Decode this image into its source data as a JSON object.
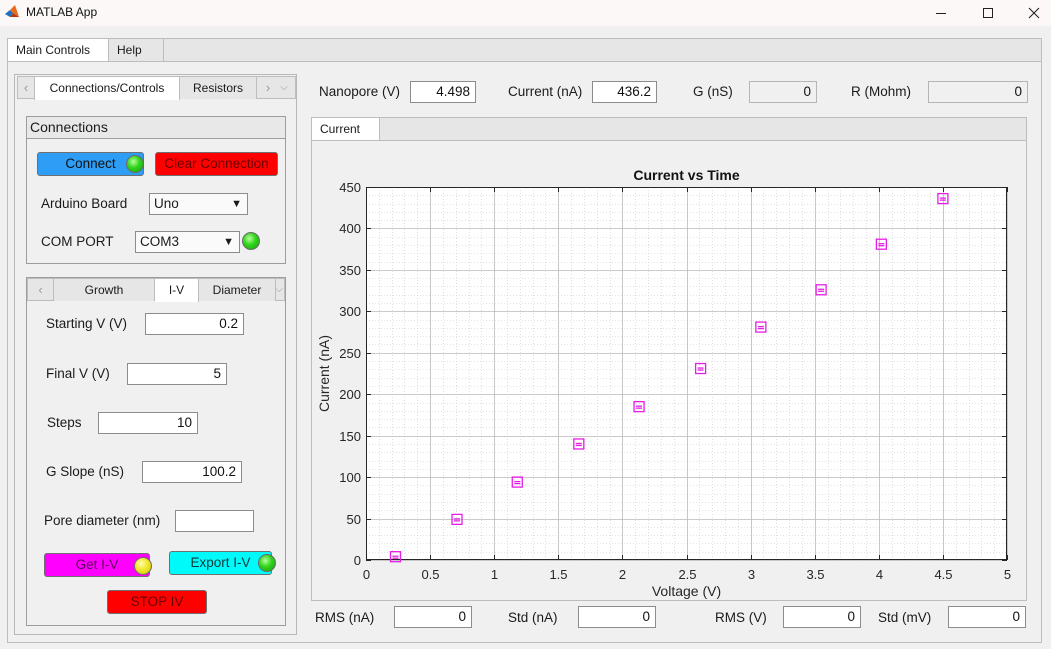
{
  "window": {
    "title": "MATLAB App"
  },
  "top_tabs": [
    {
      "label": "Main Controls"
    },
    {
      "label": "Help"
    }
  ],
  "left_tabs": [
    {
      "label": "Connections/Controls"
    },
    {
      "label": "Resistors"
    }
  ],
  "connections": {
    "title": "Connections",
    "connect_label": "Connect",
    "clear_label": "Clear Connection",
    "board_label": "Arduino Board",
    "board_value": "Uno",
    "port_label": "COM PORT",
    "port_value": "COM3"
  },
  "iv_tabs": [
    {
      "label": "Growth"
    },
    {
      "label": "I-V"
    },
    {
      "label": "Diameter"
    }
  ],
  "iv": {
    "starting_v_label": "Starting V (V)",
    "starting_v": "0.2",
    "final_v_label": "Final V  (V)",
    "final_v": "5",
    "steps_label": "Steps",
    "steps": "10",
    "g_slope_label": "G Slope (nS)",
    "g_slope": "100.2",
    "pore_label": "Pore diameter (nm)",
    "pore_value": "",
    "get_iv_label": "Get I-V",
    "export_iv_label": "Export I-V",
    "stop_label": "STOP IV"
  },
  "readouts": {
    "nanopore_label": "Nanopore (V)",
    "nanopore": "4.498",
    "current_label": "Current (nA)",
    "current": "436.2",
    "g_label": "G (nS)",
    "g": "0",
    "r_label": "R (Mohm)",
    "r": "0"
  },
  "plot_tab": {
    "label": "Current"
  },
  "bottom": {
    "rms_na_label": "RMS (nA)",
    "rms_na": "0",
    "std_na_label": "Std (nA)",
    "std_na": "0",
    "rms_v_label": "RMS (V)",
    "rms_v": "0",
    "std_mv_label": "Std (mV)",
    "std_mv": "0"
  },
  "colors": {
    "connect_btn": "#2d9df5",
    "clear_btn": "#ff0000",
    "get_iv_btn": "#ff00ff",
    "export_iv_btn": "#00fafa",
    "stop_btn": "#ff0000",
    "marker": "#e61ee6"
  },
  "chart_data": {
    "type": "scatter",
    "title": "Current vs Time",
    "xlabel": "Voltage (V)",
    "ylabel": "Current (nA)",
    "xlim": [
      0,
      5
    ],
    "ylim": [
      0,
      450
    ],
    "xticks": [
      0,
      0.5,
      1,
      1.5,
      2,
      2.5,
      3,
      3.5,
      4,
      4.5,
      5
    ],
    "yticks": [
      0,
      50,
      100,
      150,
      200,
      250,
      300,
      350,
      400,
      450
    ],
    "grid": true,
    "minor_grid": true,
    "marker": "square",
    "points": [
      {
        "x": 0.23,
        "y": 4
      },
      {
        "x": 0.71,
        "y": 49
      },
      {
        "x": 1.18,
        "y": 94
      },
      {
        "x": 1.66,
        "y": 140
      },
      {
        "x": 2.13,
        "y": 185
      },
      {
        "x": 2.61,
        "y": 231
      },
      {
        "x": 3.08,
        "y": 281
      },
      {
        "x": 3.55,
        "y": 326
      },
      {
        "x": 4.02,
        "y": 381
      },
      {
        "x": 4.5,
        "y": 436
      }
    ]
  }
}
